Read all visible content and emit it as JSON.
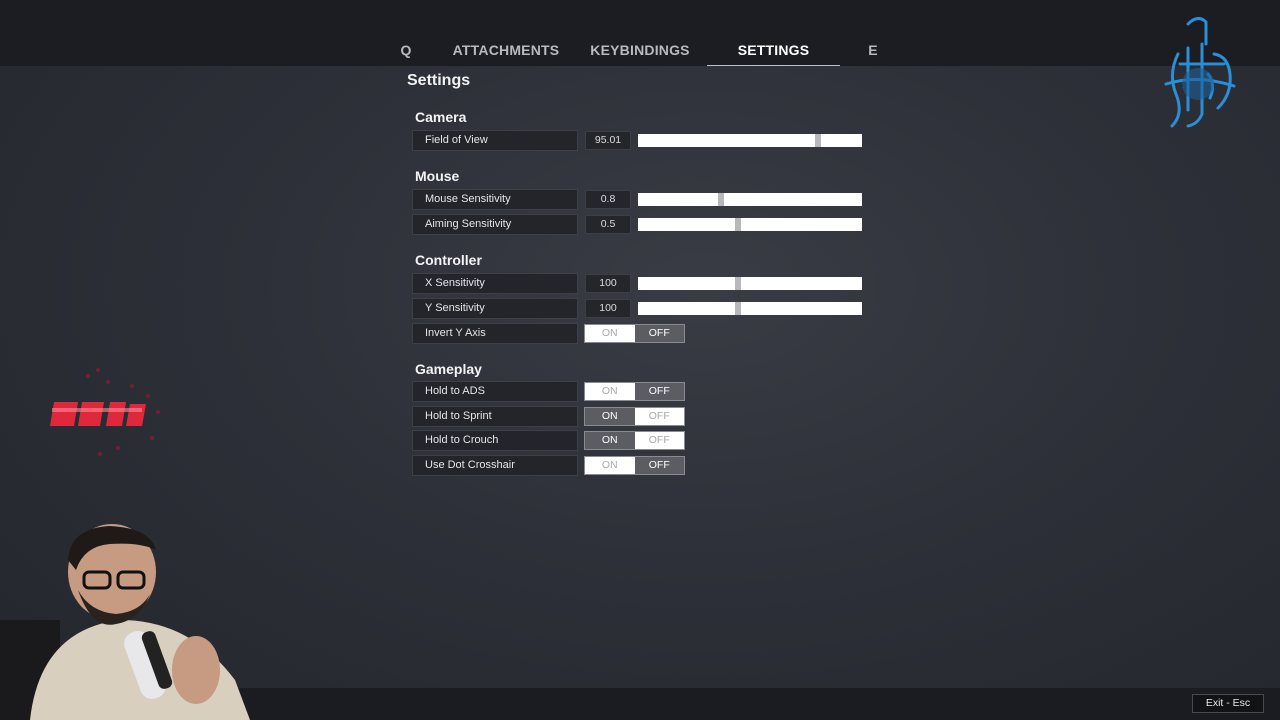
{
  "tabs": [
    {
      "label": "Q"
    },
    {
      "label": "ATTACHMENTS"
    },
    {
      "label": "KEYBINDINGS"
    },
    {
      "label": "SETTINGS"
    },
    {
      "label": "E"
    }
  ],
  "page_title": "Settings",
  "sections": {
    "camera": {
      "title": "Camera",
      "fov": {
        "label": "Field of View",
        "value": "95.01",
        "level": 0.805
      }
    },
    "mouse": {
      "title": "Mouse",
      "sensitivity": {
        "label": "Mouse Sensitivity",
        "value": "0.8",
        "level": 0.37
      },
      "aiming": {
        "label": "Aiming Sensitivity",
        "value": "0.5",
        "level": 0.445
      }
    },
    "controller": {
      "title": "Controller",
      "x": {
        "label": "X Sensitivity",
        "value": "100",
        "level": 0.445
      },
      "y": {
        "label": "Y Sensitivity",
        "value": "100",
        "level": 0.445
      },
      "invert_y": {
        "label": "Invert Y Axis",
        "state": "OFF"
      }
    },
    "gameplay": {
      "title": "Gameplay",
      "hold_ads": {
        "label": "Hold to ADS",
        "state": "OFF"
      },
      "hold_sprint": {
        "label": "Hold to Sprint",
        "state": "ON"
      },
      "hold_crouch": {
        "label": "Hold to Crouch",
        "state": "ON"
      },
      "dot_crosshair": {
        "label": "Use Dot Crosshair",
        "state": "OFF"
      }
    }
  },
  "toggle_labels": {
    "on": "ON",
    "off": "OFF"
  },
  "exit_label": "Exit - Esc",
  "colors": {
    "background": "#2e3039",
    "topbar": "#1c1d23",
    "slider_track": "#ffffff",
    "toggle_selected": "#5c5d63",
    "logo_blue": "#2a8fd6",
    "overlay_red": "#e0283c"
  }
}
